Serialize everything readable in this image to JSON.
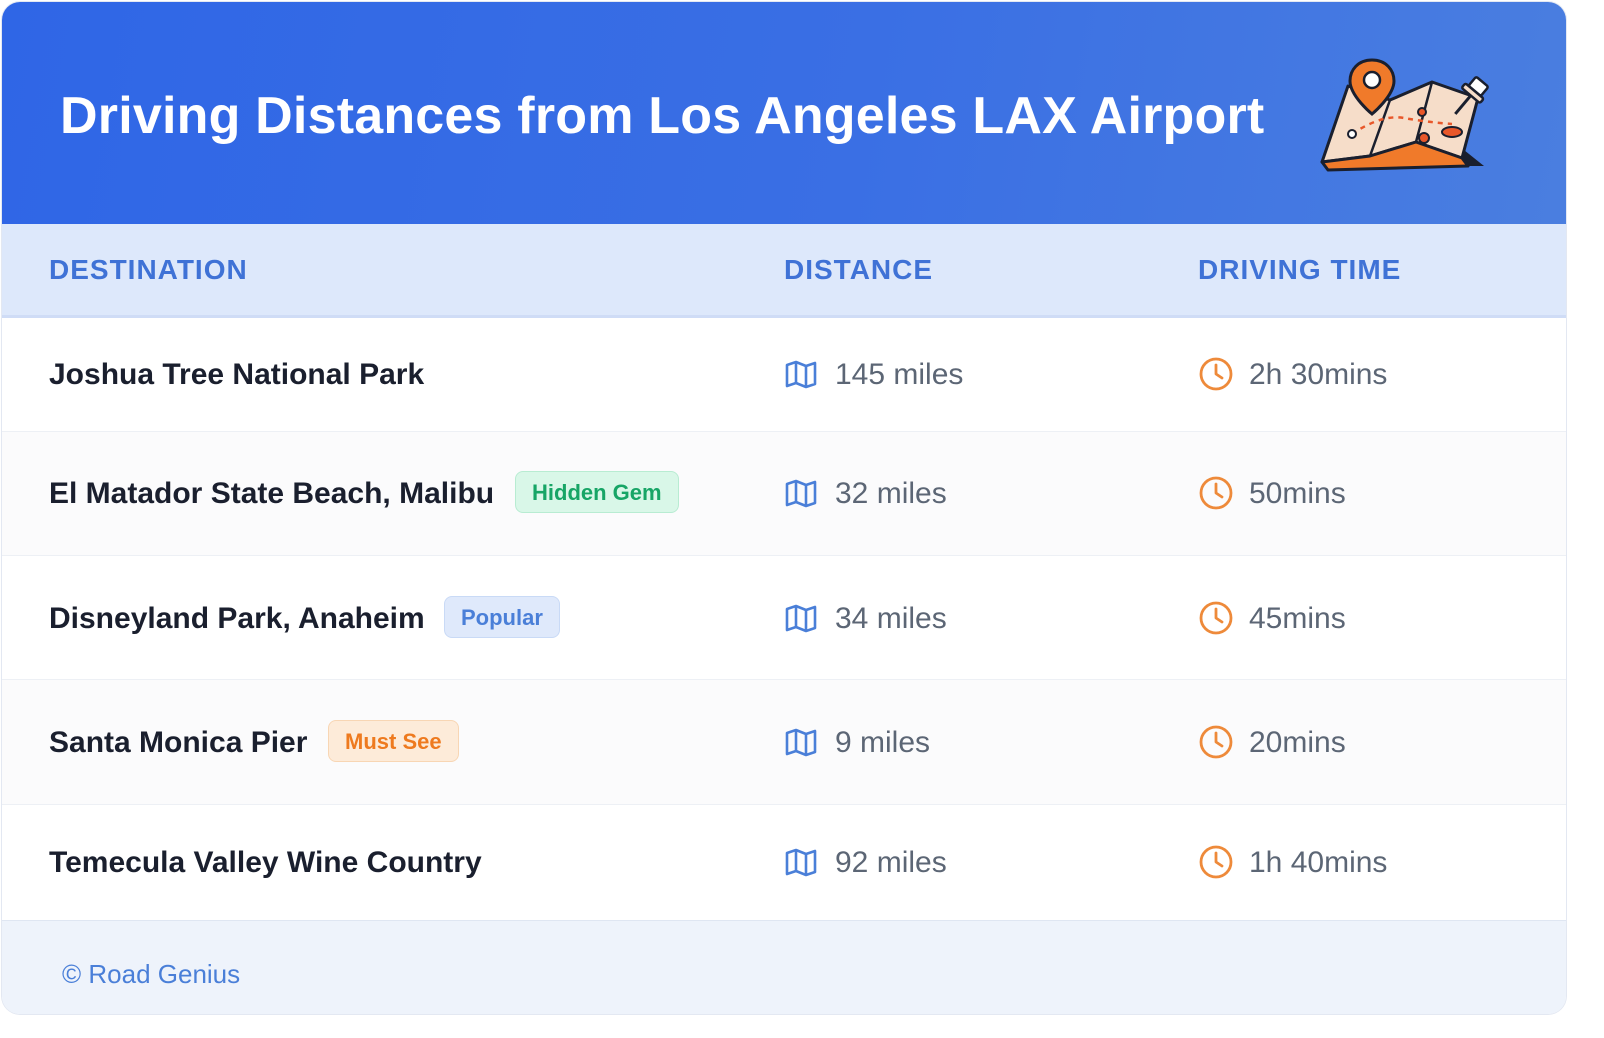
{
  "header": {
    "title": "Driving Distances from Los Angeles LAX Airport",
    "illustration_icon": "folded-map-with-location-pins"
  },
  "table": {
    "columns": [
      "DESTINATION",
      "DISTANCE",
      "DRIVING TIME"
    ],
    "rows": [
      {
        "destination": "Joshua Tree National Park",
        "badge": "",
        "distance": "145 miles",
        "time": "2h 30mins"
      },
      {
        "destination": "El Matador State Beach, Malibu",
        "badge": "Hidden Gem",
        "badge_color": "green",
        "distance": "32 miles",
        "time": "50mins"
      },
      {
        "destination": "Disneyland Park, Anaheim",
        "badge": "Popular",
        "badge_color": "blue",
        "distance": "34 miles",
        "time": "45mins"
      },
      {
        "destination": "Santa Monica Pier",
        "badge": "Must See",
        "badge_color": "orange",
        "distance": "9 miles",
        "time": "20mins"
      },
      {
        "destination": "Temecula Valley Wine Country",
        "badge": "",
        "distance": "92 miles",
        "time": "1h 40mins"
      }
    ]
  },
  "footer": {
    "credit": "© Road Genius"
  },
  "colors": {
    "header_bg": "#2f66e6",
    "column_header_bg": "#dde8fb",
    "column_header_text": "#3f72d6",
    "distance_icon": "#4a7fd8",
    "time_icon": "#ee8a3a",
    "badge_green": "#17a566",
    "badge_blue": "#4a7fd8",
    "badge_orange": "#ee7a1f"
  },
  "icons": {
    "distance": "map-icon",
    "time": "clock-icon"
  }
}
